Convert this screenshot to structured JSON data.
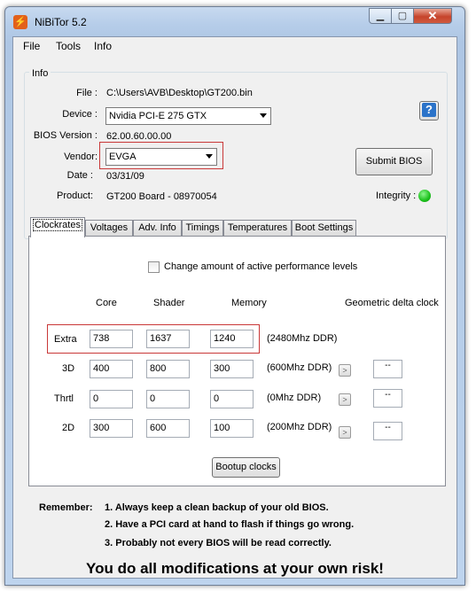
{
  "window": {
    "title": "NiBiTor 5.2"
  },
  "menu": [
    "File",
    "Tools",
    "Info"
  ],
  "info": {
    "group_title": "Info",
    "file_label": "File :",
    "file_value": "C:\\Users\\AVB\\Desktop\\GT200.bin",
    "device_label": "Device :",
    "device_value": "Nvidia PCI-E 275 GTX",
    "bios_label": "BIOS Version :",
    "bios_value": "62.00.60.00.00",
    "vendor_label": "Vendor:",
    "vendor_value": "EVGA",
    "date_label": "Date :",
    "date_value": "03/31/09",
    "product_label": "Product:",
    "product_value": "GT200 Board - 08970054",
    "integrity_label": "Integrity :",
    "integrity_color": "#1bc11b",
    "submit_label": "Submit BIOS",
    "help_label": "?"
  },
  "tabs": [
    "Clockrates",
    "Voltages",
    "Adv. Info",
    "Timings",
    "Temperatures",
    "Boot Settings"
  ],
  "clockrates": {
    "checkbox_label": "Change amount of active performance levels",
    "checkbox_checked": false,
    "headers": {
      "core": "Core",
      "shader": "Shader",
      "memory": "Memory",
      "delta": "Geometric delta clock"
    },
    "rows": [
      {
        "label": "Extra",
        "core": "738",
        "shader": "1637",
        "memory": "1240",
        "ddr": "(2480Mhz DDR)"
      },
      {
        "label": "3D",
        "core": "400",
        "shader": "800",
        "memory": "300",
        "ddr": "(600Mhz DDR)",
        "delta": "--"
      },
      {
        "label": "Thrtl",
        "core": "0",
        "shader": "0",
        "memory": "0",
        "ddr": "(0Mhz DDR)",
        "delta": "--"
      },
      {
        "label": "2D",
        "core": "300",
        "shader": "600",
        "memory": "100",
        "ddr": "(200Mhz DDR)",
        "delta": "--"
      }
    ],
    "mini_button": ">",
    "bootup_label": "Bootup clocks"
  },
  "remember": {
    "label": "Remember:",
    "lines": [
      "1. Always keep a clean backup of your old BIOS.",
      "2. Have a PCI card at hand to flash if things go wrong.",
      "3. Probably not every BIOS will be read correctly."
    ]
  },
  "warning": "You do all modifications at your own risk!",
  "colors": {
    "highlight_box": "#c93838",
    "close_button": "#c6442c"
  }
}
